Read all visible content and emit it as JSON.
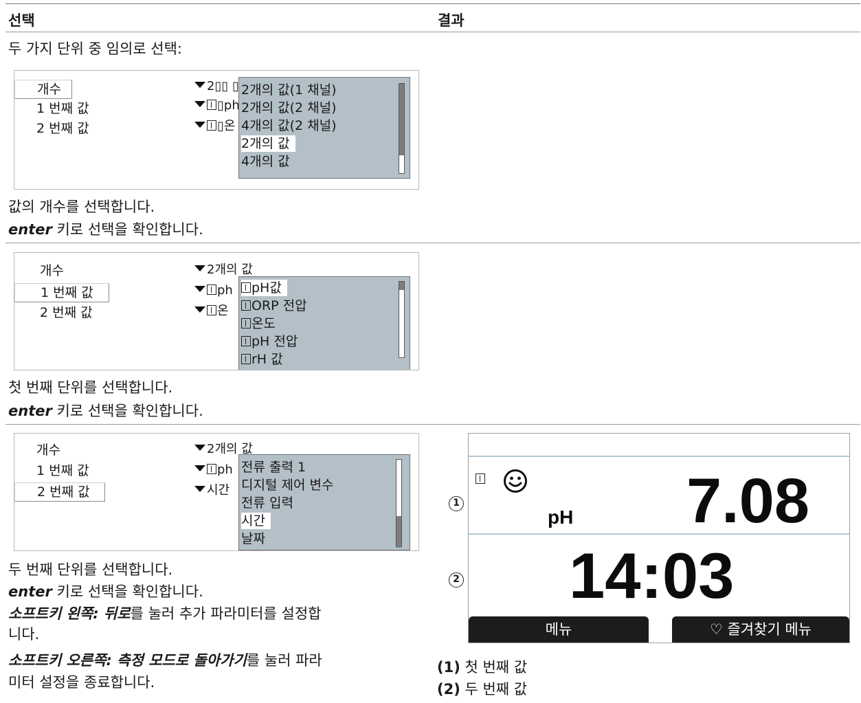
{
  "table": {
    "col_select": "선택",
    "col_result": "결과"
  },
  "intro": "두 가지 단위 중 임의로 선택:",
  "steps": [
    {
      "labels": [
        "개수",
        "1 번째 값",
        "2 번째 값"
      ],
      "values": [
        "2▯▯ ▯",
        "▯ph",
        "▯온"
      ],
      "list": [
        "2개의 값(1 채널)",
        "2개의 값(2 채널)",
        "4개의 값(2 채널)",
        "2개의 값",
        "4개의 값"
      ],
      "selected_index": 3,
      "scroll_position": 0.9,
      "note_1": "값의 개수를 선택합니다.",
      "note_2_key": "enter",
      "note_2_rest": " 키로 선택을 확인합니다."
    },
    {
      "labels": [
        "개수",
        "1 번째 값",
        "2 번째 값"
      ],
      "values": [
        "2개의 값",
        "ph",
        "온"
      ],
      "list": [
        "pH값",
        "ORP 전압",
        "온도",
        "pH 전압",
        "rH 값"
      ],
      "selected_index": 0,
      "scroll_position": 0.0,
      "note_1": "첫 번째 단위를 선택합니다.",
      "note_2_key": "enter",
      "note_2_rest": " 키로 선택을 확인합니다."
    },
    {
      "labels": [
        "개수",
        "1 번째 값",
        "2 번째 값"
      ],
      "values": [
        "2개의 값",
        "ph",
        "시간"
      ],
      "list": [
        "전류 출력 1",
        "디지털 제어 변수",
        "전류 입력",
        "시간",
        "날짜"
      ],
      "selected_index": 3,
      "scroll_position": 1.0,
      "note_1": "두 번째 단위를 선택합니다.",
      "note_2_key": "enter",
      "note_2_rest": " 키로 선택을 확인합니다.",
      "note_3_em": "소프트키 왼쪽: 뒤로",
      "note_3_rest": "를 눌러 추가 파라미터를 설정합",
      "note_3_cont": "니다.",
      "note_4_em": "소프트키 오른쪽: 측정 모드로 돌아가기",
      "note_4_rest": "를 눌러 파라",
      "note_4_cont": "미터 설정을 종료합니다."
    }
  ],
  "device": {
    "value_1": "7.08",
    "unit_1": "pH",
    "status_icon": "smiley-icon",
    "value_2": "14:03",
    "softkey_left": "메뉴",
    "softkey_right": "♡ 즐겨찾기 메뉴",
    "marker_1": "1",
    "marker_2": "2"
  },
  "legend": [
    {
      "num": "(1)",
      "text": " 첫 번째 값"
    },
    {
      "num": "(2)",
      "text": " 두 번째 값"
    }
  ]
}
